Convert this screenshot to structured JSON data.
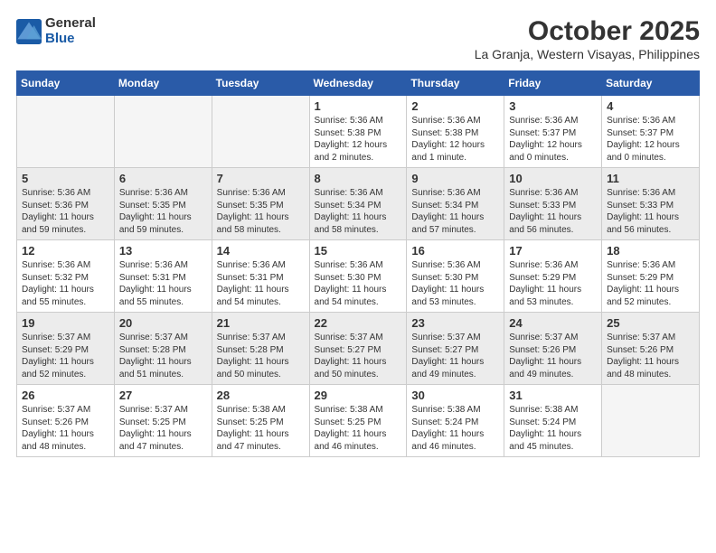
{
  "logo": {
    "general": "General",
    "blue": "Blue"
  },
  "header": {
    "month": "October 2025",
    "location": "La Granja, Western Visayas, Philippines"
  },
  "weekdays": [
    "Sunday",
    "Monday",
    "Tuesday",
    "Wednesday",
    "Thursday",
    "Friday",
    "Saturday"
  ],
  "weeks": [
    [
      {
        "day": "",
        "info": ""
      },
      {
        "day": "",
        "info": ""
      },
      {
        "day": "",
        "info": ""
      },
      {
        "day": "1",
        "info": "Sunrise: 5:36 AM\nSunset: 5:38 PM\nDaylight: 12 hours\nand 2 minutes."
      },
      {
        "day": "2",
        "info": "Sunrise: 5:36 AM\nSunset: 5:38 PM\nDaylight: 12 hours\nand 1 minute."
      },
      {
        "day": "3",
        "info": "Sunrise: 5:36 AM\nSunset: 5:37 PM\nDaylight: 12 hours\nand 0 minutes."
      },
      {
        "day": "4",
        "info": "Sunrise: 5:36 AM\nSunset: 5:37 PM\nDaylight: 12 hours\nand 0 minutes."
      }
    ],
    [
      {
        "day": "5",
        "info": "Sunrise: 5:36 AM\nSunset: 5:36 PM\nDaylight: 11 hours\nand 59 minutes."
      },
      {
        "day": "6",
        "info": "Sunrise: 5:36 AM\nSunset: 5:35 PM\nDaylight: 11 hours\nand 59 minutes."
      },
      {
        "day": "7",
        "info": "Sunrise: 5:36 AM\nSunset: 5:35 PM\nDaylight: 11 hours\nand 58 minutes."
      },
      {
        "day": "8",
        "info": "Sunrise: 5:36 AM\nSunset: 5:34 PM\nDaylight: 11 hours\nand 58 minutes."
      },
      {
        "day": "9",
        "info": "Sunrise: 5:36 AM\nSunset: 5:34 PM\nDaylight: 11 hours\nand 57 minutes."
      },
      {
        "day": "10",
        "info": "Sunrise: 5:36 AM\nSunset: 5:33 PM\nDaylight: 11 hours\nand 56 minutes."
      },
      {
        "day": "11",
        "info": "Sunrise: 5:36 AM\nSunset: 5:33 PM\nDaylight: 11 hours\nand 56 minutes."
      }
    ],
    [
      {
        "day": "12",
        "info": "Sunrise: 5:36 AM\nSunset: 5:32 PM\nDaylight: 11 hours\nand 55 minutes."
      },
      {
        "day": "13",
        "info": "Sunrise: 5:36 AM\nSunset: 5:31 PM\nDaylight: 11 hours\nand 55 minutes."
      },
      {
        "day": "14",
        "info": "Sunrise: 5:36 AM\nSunset: 5:31 PM\nDaylight: 11 hours\nand 54 minutes."
      },
      {
        "day": "15",
        "info": "Sunrise: 5:36 AM\nSunset: 5:30 PM\nDaylight: 11 hours\nand 54 minutes."
      },
      {
        "day": "16",
        "info": "Sunrise: 5:36 AM\nSunset: 5:30 PM\nDaylight: 11 hours\nand 53 minutes."
      },
      {
        "day": "17",
        "info": "Sunrise: 5:36 AM\nSunset: 5:29 PM\nDaylight: 11 hours\nand 53 minutes."
      },
      {
        "day": "18",
        "info": "Sunrise: 5:36 AM\nSunset: 5:29 PM\nDaylight: 11 hours\nand 52 minutes."
      }
    ],
    [
      {
        "day": "19",
        "info": "Sunrise: 5:37 AM\nSunset: 5:29 PM\nDaylight: 11 hours\nand 52 minutes."
      },
      {
        "day": "20",
        "info": "Sunrise: 5:37 AM\nSunset: 5:28 PM\nDaylight: 11 hours\nand 51 minutes."
      },
      {
        "day": "21",
        "info": "Sunrise: 5:37 AM\nSunset: 5:28 PM\nDaylight: 11 hours\nand 50 minutes."
      },
      {
        "day": "22",
        "info": "Sunrise: 5:37 AM\nSunset: 5:27 PM\nDaylight: 11 hours\nand 50 minutes."
      },
      {
        "day": "23",
        "info": "Sunrise: 5:37 AM\nSunset: 5:27 PM\nDaylight: 11 hours\nand 49 minutes."
      },
      {
        "day": "24",
        "info": "Sunrise: 5:37 AM\nSunset: 5:26 PM\nDaylight: 11 hours\nand 49 minutes."
      },
      {
        "day": "25",
        "info": "Sunrise: 5:37 AM\nSunset: 5:26 PM\nDaylight: 11 hours\nand 48 minutes."
      }
    ],
    [
      {
        "day": "26",
        "info": "Sunrise: 5:37 AM\nSunset: 5:26 PM\nDaylight: 11 hours\nand 48 minutes."
      },
      {
        "day": "27",
        "info": "Sunrise: 5:37 AM\nSunset: 5:25 PM\nDaylight: 11 hours\nand 47 minutes."
      },
      {
        "day": "28",
        "info": "Sunrise: 5:38 AM\nSunset: 5:25 PM\nDaylight: 11 hours\nand 47 minutes."
      },
      {
        "day": "29",
        "info": "Sunrise: 5:38 AM\nSunset: 5:25 PM\nDaylight: 11 hours\nand 46 minutes."
      },
      {
        "day": "30",
        "info": "Sunrise: 5:38 AM\nSunset: 5:24 PM\nDaylight: 11 hours\nand 46 minutes."
      },
      {
        "day": "31",
        "info": "Sunrise: 5:38 AM\nSunset: 5:24 PM\nDaylight: 11 hours\nand 45 minutes."
      },
      {
        "day": "",
        "info": ""
      }
    ]
  ]
}
